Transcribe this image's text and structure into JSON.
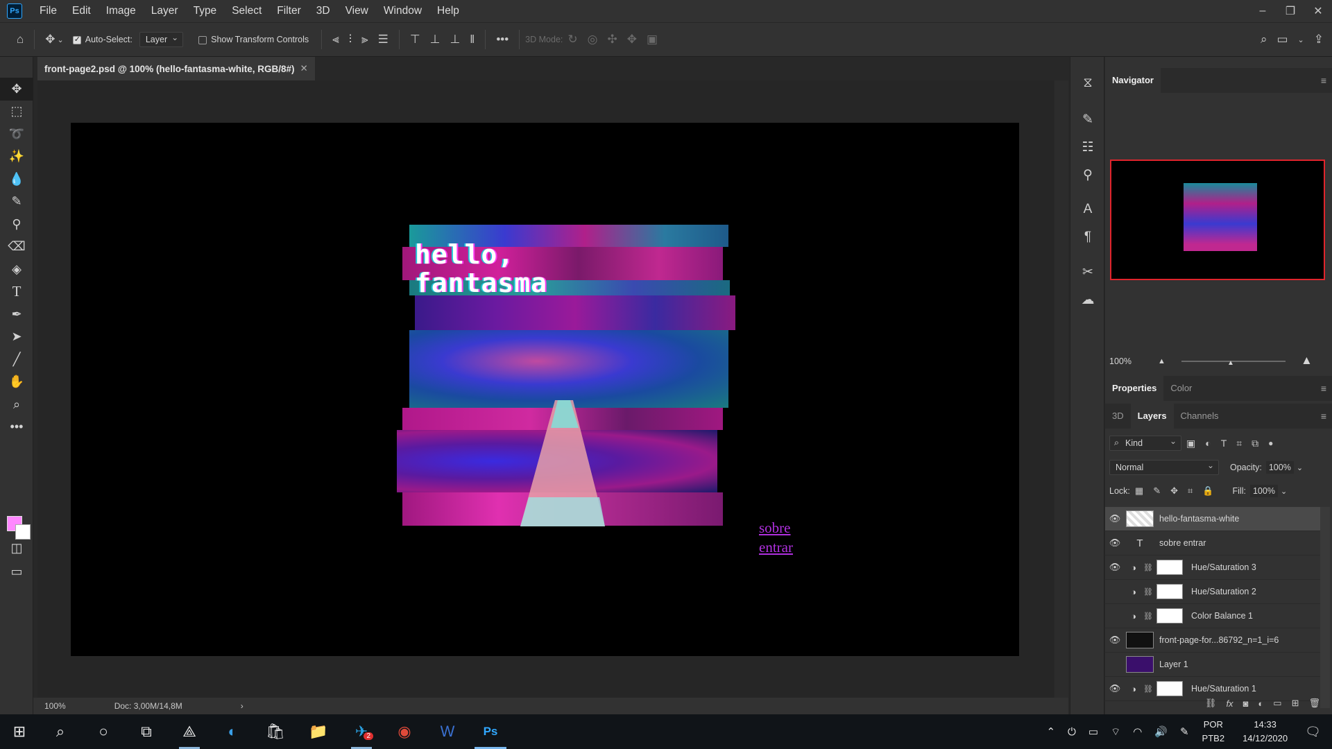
{
  "app": {
    "logo": "Ps"
  },
  "menu": [
    "File",
    "Edit",
    "Image",
    "Layer",
    "Type",
    "Select",
    "Filter",
    "3D",
    "View",
    "Window",
    "Help"
  ],
  "window_controls": {
    "minimize": "–",
    "restore": "❐",
    "close": "✕"
  },
  "options": {
    "auto_select_label": "Auto-Select:",
    "auto_select_checked": true,
    "auto_select_target": "Layer",
    "show_transform_label": "Show Transform Controls",
    "show_transform_checked": false,
    "mode_3d_label": "3D Mode:",
    "more": "•••"
  },
  "document": {
    "tab_title": "front-page2.psd @ 100% (hello-fantasma-white, RGB/8#)",
    "close": "✕",
    "zoom": "100%",
    "doc_info": "Doc: 3,00M/14,8M",
    "art_title_line1": "hello,",
    "art_title_line2": "fantasma",
    "link1": "sobre",
    "link2": "entrar"
  },
  "colors": {
    "foreground": "#ff88ff",
    "background": "#ffffff",
    "accent": "#31a8ff",
    "nav_frame": "#e0242c"
  },
  "navigator": {
    "tab": "Navigator",
    "zoom": "100%"
  },
  "properties_tabs": [
    "Properties",
    "Color"
  ],
  "layers_tabs": [
    "3D",
    "Layers",
    "Channels"
  ],
  "layers_panel": {
    "filter_kind": "Kind",
    "blend_mode": "Normal",
    "opacity_label": "Opacity:",
    "opacity": "100%",
    "lock_label": "Lock:",
    "fill_label": "Fill:",
    "fill": "100%"
  },
  "layers": [
    {
      "name": "hello-fantasma-white",
      "visible": true,
      "kind": "smart",
      "selected": true
    },
    {
      "name": "sobre entrar",
      "visible": true,
      "kind": "type"
    },
    {
      "name": "Hue/Saturation 3",
      "visible": true,
      "kind": "adjustment"
    },
    {
      "name": "Hue/Saturation 2",
      "visible": false,
      "kind": "adjustment"
    },
    {
      "name": "Color Balance 1",
      "visible": false,
      "kind": "adjustment"
    },
    {
      "name": "front-page-for...86792_n=1_i=6",
      "visible": true,
      "kind": "smart-dark"
    },
    {
      "name": "Layer 1",
      "visible": false,
      "kind": "pixel-purple"
    },
    {
      "name": "Hue/Saturation 1",
      "visible": true,
      "kind": "adjustment"
    }
  ],
  "taskbar": {
    "language": "POR",
    "layout": "PTB2",
    "time": "14:33",
    "date": "14/12/2020",
    "telegram_badge": "2"
  }
}
